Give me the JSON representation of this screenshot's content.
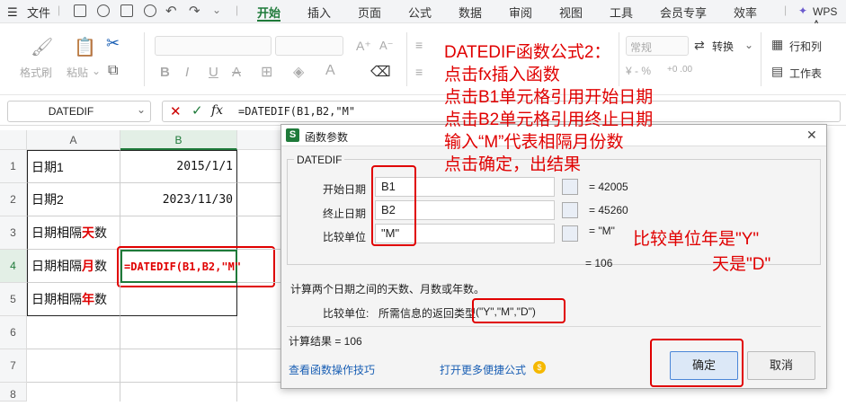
{
  "menubar": {
    "file": "文件",
    "tabs": [
      "开始",
      "插入",
      "页面",
      "公式",
      "数据",
      "审阅",
      "视图",
      "工具",
      "会员专享",
      "效率"
    ],
    "wps_ai": "WPS A"
  },
  "ribbon": {
    "format_painter": "格式刷",
    "paste": "粘贴",
    "font_size_up": "A⁺",
    "font_size_down": "A⁻",
    "bold": "B",
    "number_format": "常规",
    "convert": "转换",
    "rows_cols": "行和列",
    "worksheet": "工作表",
    "percent": "¥ ‐ %",
    "decimals": "+0 .00"
  },
  "formula_bar": {
    "name_box": "DATEDIF",
    "formula": "=DATEDIF(B1,B2,\"M\""
  },
  "sheet": {
    "columns": [
      "A",
      "B"
    ],
    "rows": [
      "1",
      "2",
      "3",
      "4",
      "5",
      "6",
      "7",
      "8"
    ],
    "a1": "日期1",
    "b1": "2015/1/1",
    "a2": "日期2",
    "b2": "2023/11/30",
    "a3_pre": "日期相隔",
    "a3_red": "天",
    "a3_post": "数",
    "a4_pre": "日期相隔",
    "a4_red": "月",
    "a4_post": "数",
    "a5_pre": "日期相隔",
    "a5_red": "年",
    "a5_post": "数",
    "b4": "=DATEDIF(B1,B2,\"M\""
  },
  "dialog": {
    "title": "函数参数",
    "func_name": "DATEDIF",
    "args": [
      {
        "label": "开始日期",
        "value": "B1",
        "result": "= 42005"
      },
      {
        "label": "终止日期",
        "value": "B2",
        "result": "= 45260"
      },
      {
        "label": "比较单位",
        "value": "\"M\"",
        "result": "= \"M\""
      }
    ],
    "eq_result": "= 106",
    "description": "计算两个日期之间的天数、月数或年数。",
    "param_label": "比较单位:",
    "param_desc_pre": "所需信息的返回类型",
    "param_desc_types": "(\"Y\",\"M\",\"D\")",
    "calc_result": "计算结果 = 106",
    "link_tips": "查看函数操作技巧",
    "link_more": "打开更多便捷公式",
    "ok": "确定",
    "cancel": "取消"
  },
  "annotation": {
    "lines": [
      "DATEDIF函数公式2：",
      "点击fx插入函数",
      "点击B1单元格引用开始日期",
      "点击B2单元格引用终止日期",
      "输入“M”代表相隔月份数",
      "点击确定，出结果"
    ],
    "note1": "比较单位年是\"Y\"",
    "note2": "天是\"D\""
  },
  "colors": {
    "accent_green": "#1f7a3a",
    "annotation_red": "#e00000"
  }
}
